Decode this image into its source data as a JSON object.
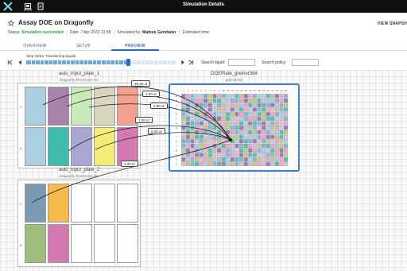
{
  "topbar": {
    "app_title": "Simulation Details"
  },
  "header": {
    "title": "Assay DOE on Dragonfly",
    "snapshot_label": "VIEW SNAPSH"
  },
  "status": {
    "status_label": "Status:",
    "status_value": "Simulation succeeded",
    "date": "Date: 7 Apr 2022 13:58",
    "simulated_by_label": "Simulated by:",
    "simulated_by": "Markus Gershater",
    "estimated": "Estimated time:"
  },
  "tabs": [
    {
      "label": "OVERVIEW"
    },
    {
      "label": "SETUP"
    },
    {
      "label": "PREVIEW"
    }
  ],
  "playback": {
    "step_label": "Step 23/34: Transferring liquids",
    "progress": 0.68,
    "search_liquid_label": "Search liquid:",
    "search_policy_label": "Search policy:"
  },
  "plates": {
    "src1": {
      "name": "auto_input_plate_1",
      "sub": "Dragonfly Reservoirs NV",
      "row_a": "A",
      "row_b": "B",
      "colors": [
        "#a9cfe1",
        "#a882ab",
        "#c9e9b9",
        "#d8d7be",
        "#f2a08f",
        "#a9cfe1",
        "#3fbcad",
        "#a7a7d2",
        "#f8ec78",
        "#d57ab0"
      ]
    },
    "src2": {
      "name": "auto_input_plate_2",
      "sub": "Dragonfly Reservoirs NV",
      "row_a": "A",
      "row_b": "B",
      "colors": [
        "#7b9bb5",
        "#f8bb4b",
        "#ffffff",
        "#ffffff",
        "#ffffff",
        "#9ebd7c",
        "#d57ab0",
        "#ffffff",
        "#ffffff",
        "#ffffff"
      ]
    },
    "target": {
      "name": "DOEPlate_greiner384",
      "sub": "greiner384",
      "cols": [
        "1",
        "2",
        "3",
        "4",
        "5",
        "6",
        "7",
        "8",
        "9",
        "10",
        "11",
        "12",
        "13",
        "14",
        "15",
        "16",
        "17",
        "18",
        "19",
        "20",
        "21",
        "22",
        "23",
        "24"
      ],
      "rows": [
        "A",
        "B",
        "C",
        "D",
        "E",
        "F",
        "G",
        "H",
        "I",
        "J",
        "K",
        "L",
        "M",
        "N",
        "O",
        "P"
      ]
    }
  },
  "transfers": [
    {
      "volume": "39.40 ul"
    },
    {
      "volume": "1.00 ul"
    },
    {
      "volume": "2.60 ul"
    },
    {
      "volume": "1.00 ul"
    },
    {
      "volume": "6.00 ul"
    },
    {
      "volume": "1.00 ul"
    }
  ]
}
